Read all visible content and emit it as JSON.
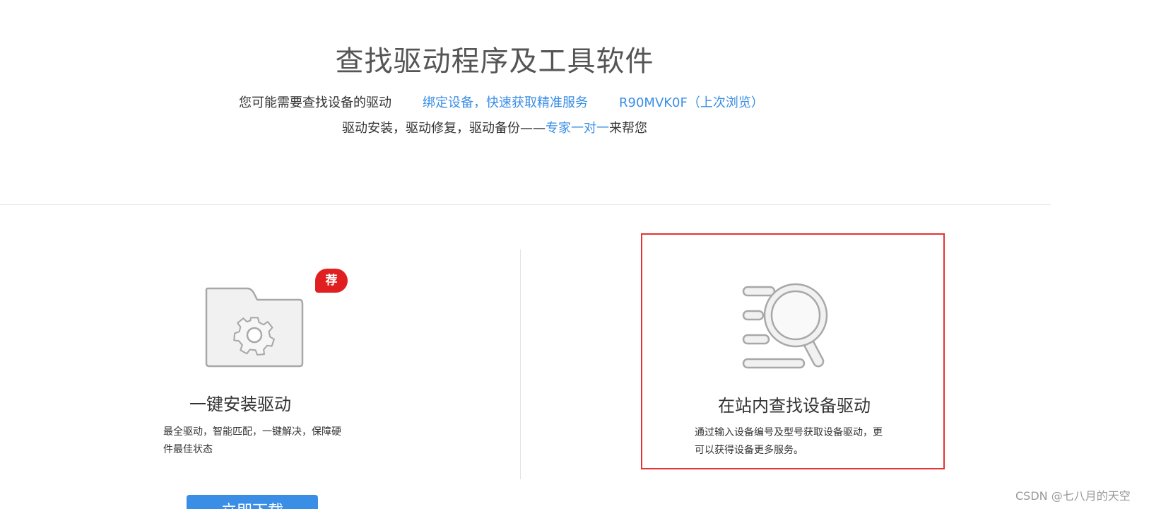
{
  "header": {
    "title": "查找驱动程序及工具软件",
    "prompt_text": "您可能需要查找设备的驱动",
    "bind_device_link": "绑定设备，快速获取精准服务",
    "recent_device_link": "R90MVK0F（上次浏览）",
    "support_text_before": "驱动安装，驱动修复，驱动备份——",
    "expert_link": "专家一对一",
    "support_text_after": "来帮您"
  },
  "cards": {
    "install": {
      "badge": "荐",
      "title": "一键安装驱动",
      "description": "最全驱动，智能匹配，一键解决，保障硬件最佳状态",
      "button": "立即下载",
      "icon": "folder-gear-icon"
    },
    "search": {
      "title": "在站内查找设备驱动",
      "description": "通过输入设备编号及型号获取设备驱动，更可以获得设备更多服务。",
      "icon": "search-list-icon"
    }
  },
  "watermark": "CSDN @七八月的天空",
  "colors": {
    "link": "#3a8ee6",
    "badge": "#e02020",
    "highlight_border": "#e63232",
    "button": "#3a8ee6"
  }
}
